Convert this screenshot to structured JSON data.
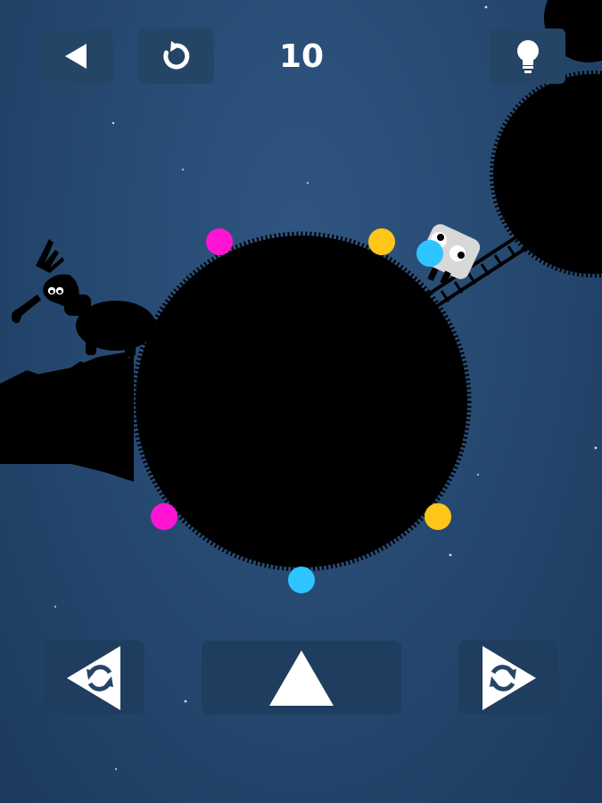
{
  "hud": {
    "moves_count": "10",
    "back_icon": "back-triangle-icon",
    "restart_icon": "restart-icon",
    "hint_icon": "lightbulb-icon"
  },
  "controls": {
    "rotate_left_icon": "rotate-left-icon",
    "jump_icon": "jump-triangle-icon",
    "rotate_right_icon": "rotate-right-icon"
  },
  "colors": {
    "background": "#274a72",
    "button": "#244566",
    "planet": "#000000",
    "magenta": "#ff14d4",
    "yellow": "#ffc61a",
    "cyan": "#2ec4ff"
  },
  "orbs": [
    {
      "color": "magenta"
    },
    {
      "color": "yellow"
    },
    {
      "color": "magenta"
    },
    {
      "color": "yellow"
    },
    {
      "color": "cyan"
    }
  ]
}
